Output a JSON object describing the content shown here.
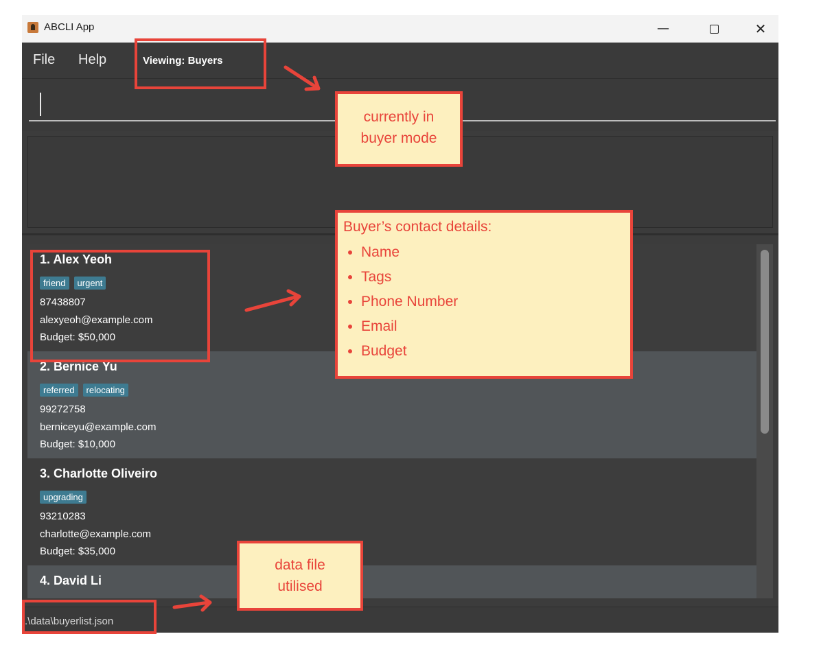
{
  "window": {
    "title": "ABCLI App",
    "controls": {
      "minimize": "—",
      "close": "✕"
    }
  },
  "menu": {
    "file": "File",
    "help": "Help",
    "viewing": "Viewing: Buyers"
  },
  "command": {
    "value": "",
    "placeholder": ""
  },
  "buyers": [
    {
      "name": "1. Alex Yeoh",
      "tags": [
        "friend",
        "urgent"
      ],
      "phone": "87438807",
      "email": "alexyeoh@example.com",
      "budget": "Budget: $50,000"
    },
    {
      "name": "2. Bernice Yu",
      "tags": [
        "referred",
        "relocating"
      ],
      "phone": "99272758",
      "email": "berniceyu@example.com",
      "budget": "Budget: $10,000"
    },
    {
      "name": "3. Charlotte Oliveiro",
      "tags": [
        "upgrading"
      ],
      "phone": "93210283",
      "email": "charlotte@example.com",
      "budget": "Budget: $35,000"
    },
    {
      "name": "4. David Li",
      "tags": [],
      "phone": "",
      "email": "",
      "budget": ""
    }
  ],
  "status": {
    "file_path": ".\\data\\buyerlist.json"
  },
  "annotations": {
    "mode_note": [
      "currently in",
      "buyer mode"
    ],
    "details_note": {
      "title": "Buyer’s contact details:",
      "items": [
        "Name",
        "Tags",
        "Phone Number",
        "Email",
        "Budget"
      ]
    },
    "file_note": [
      "data file",
      "utilised"
    ],
    "color": "#e8443a",
    "note_bg": "#fdf0bf"
  }
}
